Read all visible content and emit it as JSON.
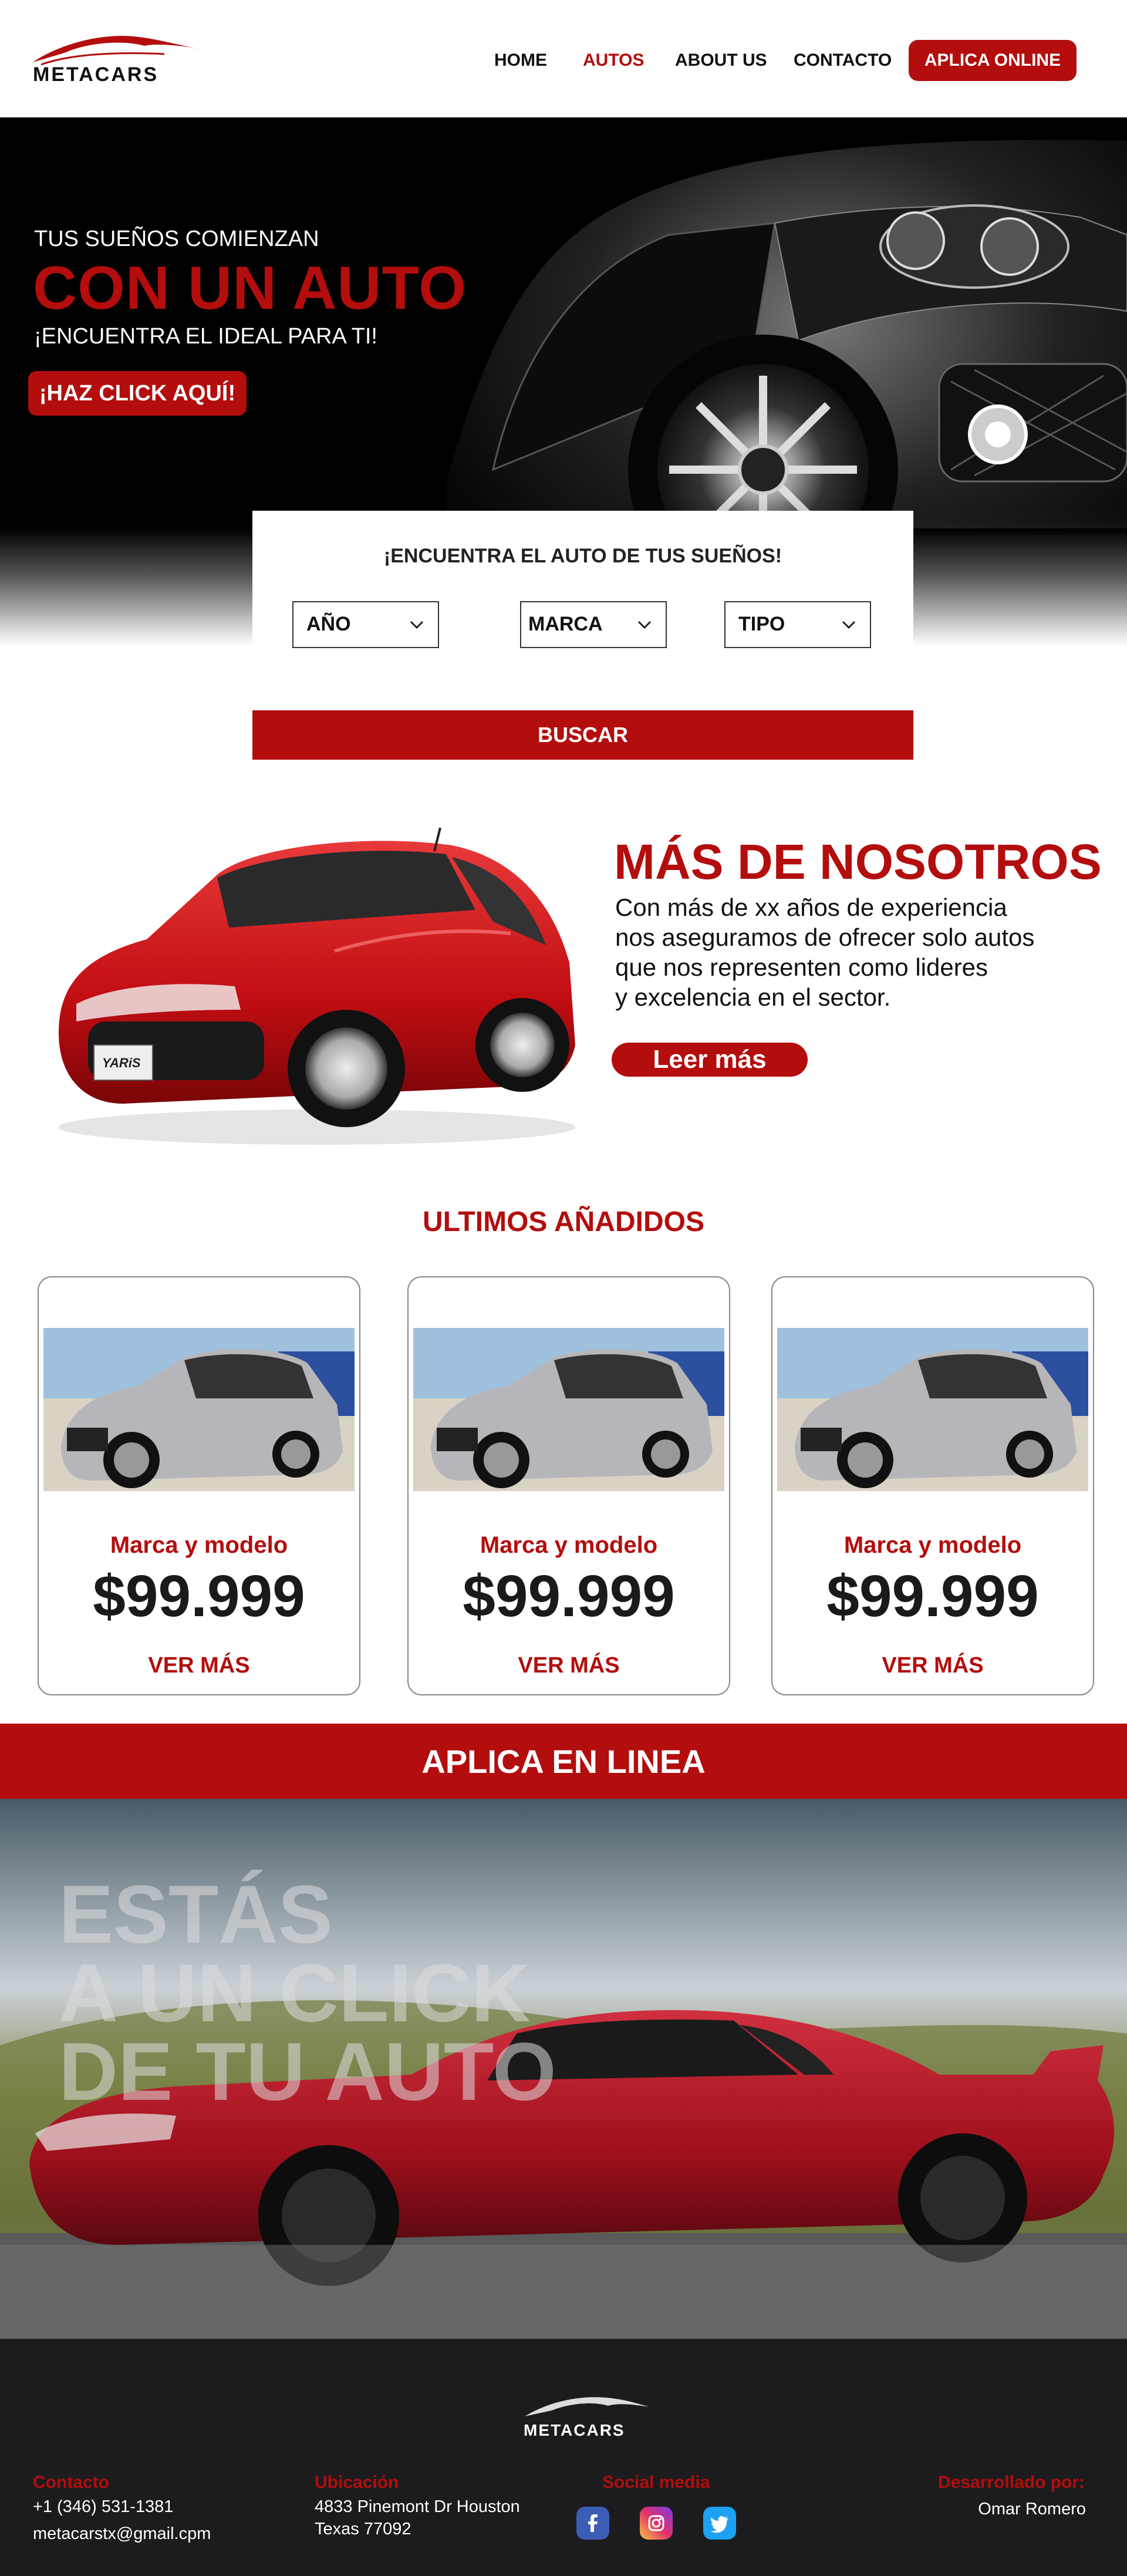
{
  "header": {
    "logo_text": "METACARS",
    "nav": [
      {
        "label": "HOME"
      },
      {
        "label": "AUTOS"
      },
      {
        "label": "ABOUT US"
      },
      {
        "label": "CONTACTO"
      }
    ],
    "cta_label": "APLICA ONLINE"
  },
  "hero": {
    "line1": "TUS SUEÑOS COMIENZAN",
    "line2": "CON UN AUTO",
    "line3": "¡ENCUENTRA EL IDEAL PARA TI!",
    "button_label": "¡HAZ CLICK AQUÍ!"
  },
  "search": {
    "title": "¡ENCUENTRA EL AUTO DE TUS SUEÑOS!",
    "filters": [
      {
        "label": "AÑO"
      },
      {
        "label": "MARCA"
      },
      {
        "label": "TIPO"
      }
    ],
    "button_label": "BUSCAR"
  },
  "about": {
    "title": "MÁS DE NOSOTROS",
    "text": "Con más de xx años de experiencia\nnos aseguramos de ofrecer solo autos\nque nos representen como lideres\ny excelencia en el sector.",
    "button_label": "Leer más",
    "plate_text": "YARiS"
  },
  "latest": {
    "title": "ULTIMOS AÑADIDOS",
    "cards": [
      {
        "model": "Marca y modelo",
        "price": "$99.999",
        "link": "VER MÁS"
      },
      {
        "model": "Marca y modelo",
        "price": "$99.999",
        "link": "VER MÁS"
      },
      {
        "model": "Marca y modelo",
        "price": "$99.999",
        "link": "VER MÁS"
      }
    ]
  },
  "apply": {
    "title": "APLICA EN LINEA",
    "promo_lines": [
      "ESTÁS",
      "A UN CLICK",
      "DE TU AUTO"
    ]
  },
  "footer": {
    "logo_text": "METACARS",
    "contact": {
      "heading": "Contacto",
      "phone": "+1 (346) 531-1381",
      "email": "metacarstx@gmail.cpm"
    },
    "location": {
      "heading": "Ubicación",
      "line1": "4833 Pinemont Dr Houston",
      "line2": "Texas 77092"
    },
    "social": {
      "heading": "Social media",
      "icons": [
        "facebook-icon",
        "instagram-icon",
        "twitter-icon"
      ]
    },
    "credits": {
      "heading": "Desarrollado por:",
      "name": "Omar Romero"
    }
  },
  "colors": {
    "accent": "#b30d0d",
    "footer_bg": "#1c1c1e"
  }
}
